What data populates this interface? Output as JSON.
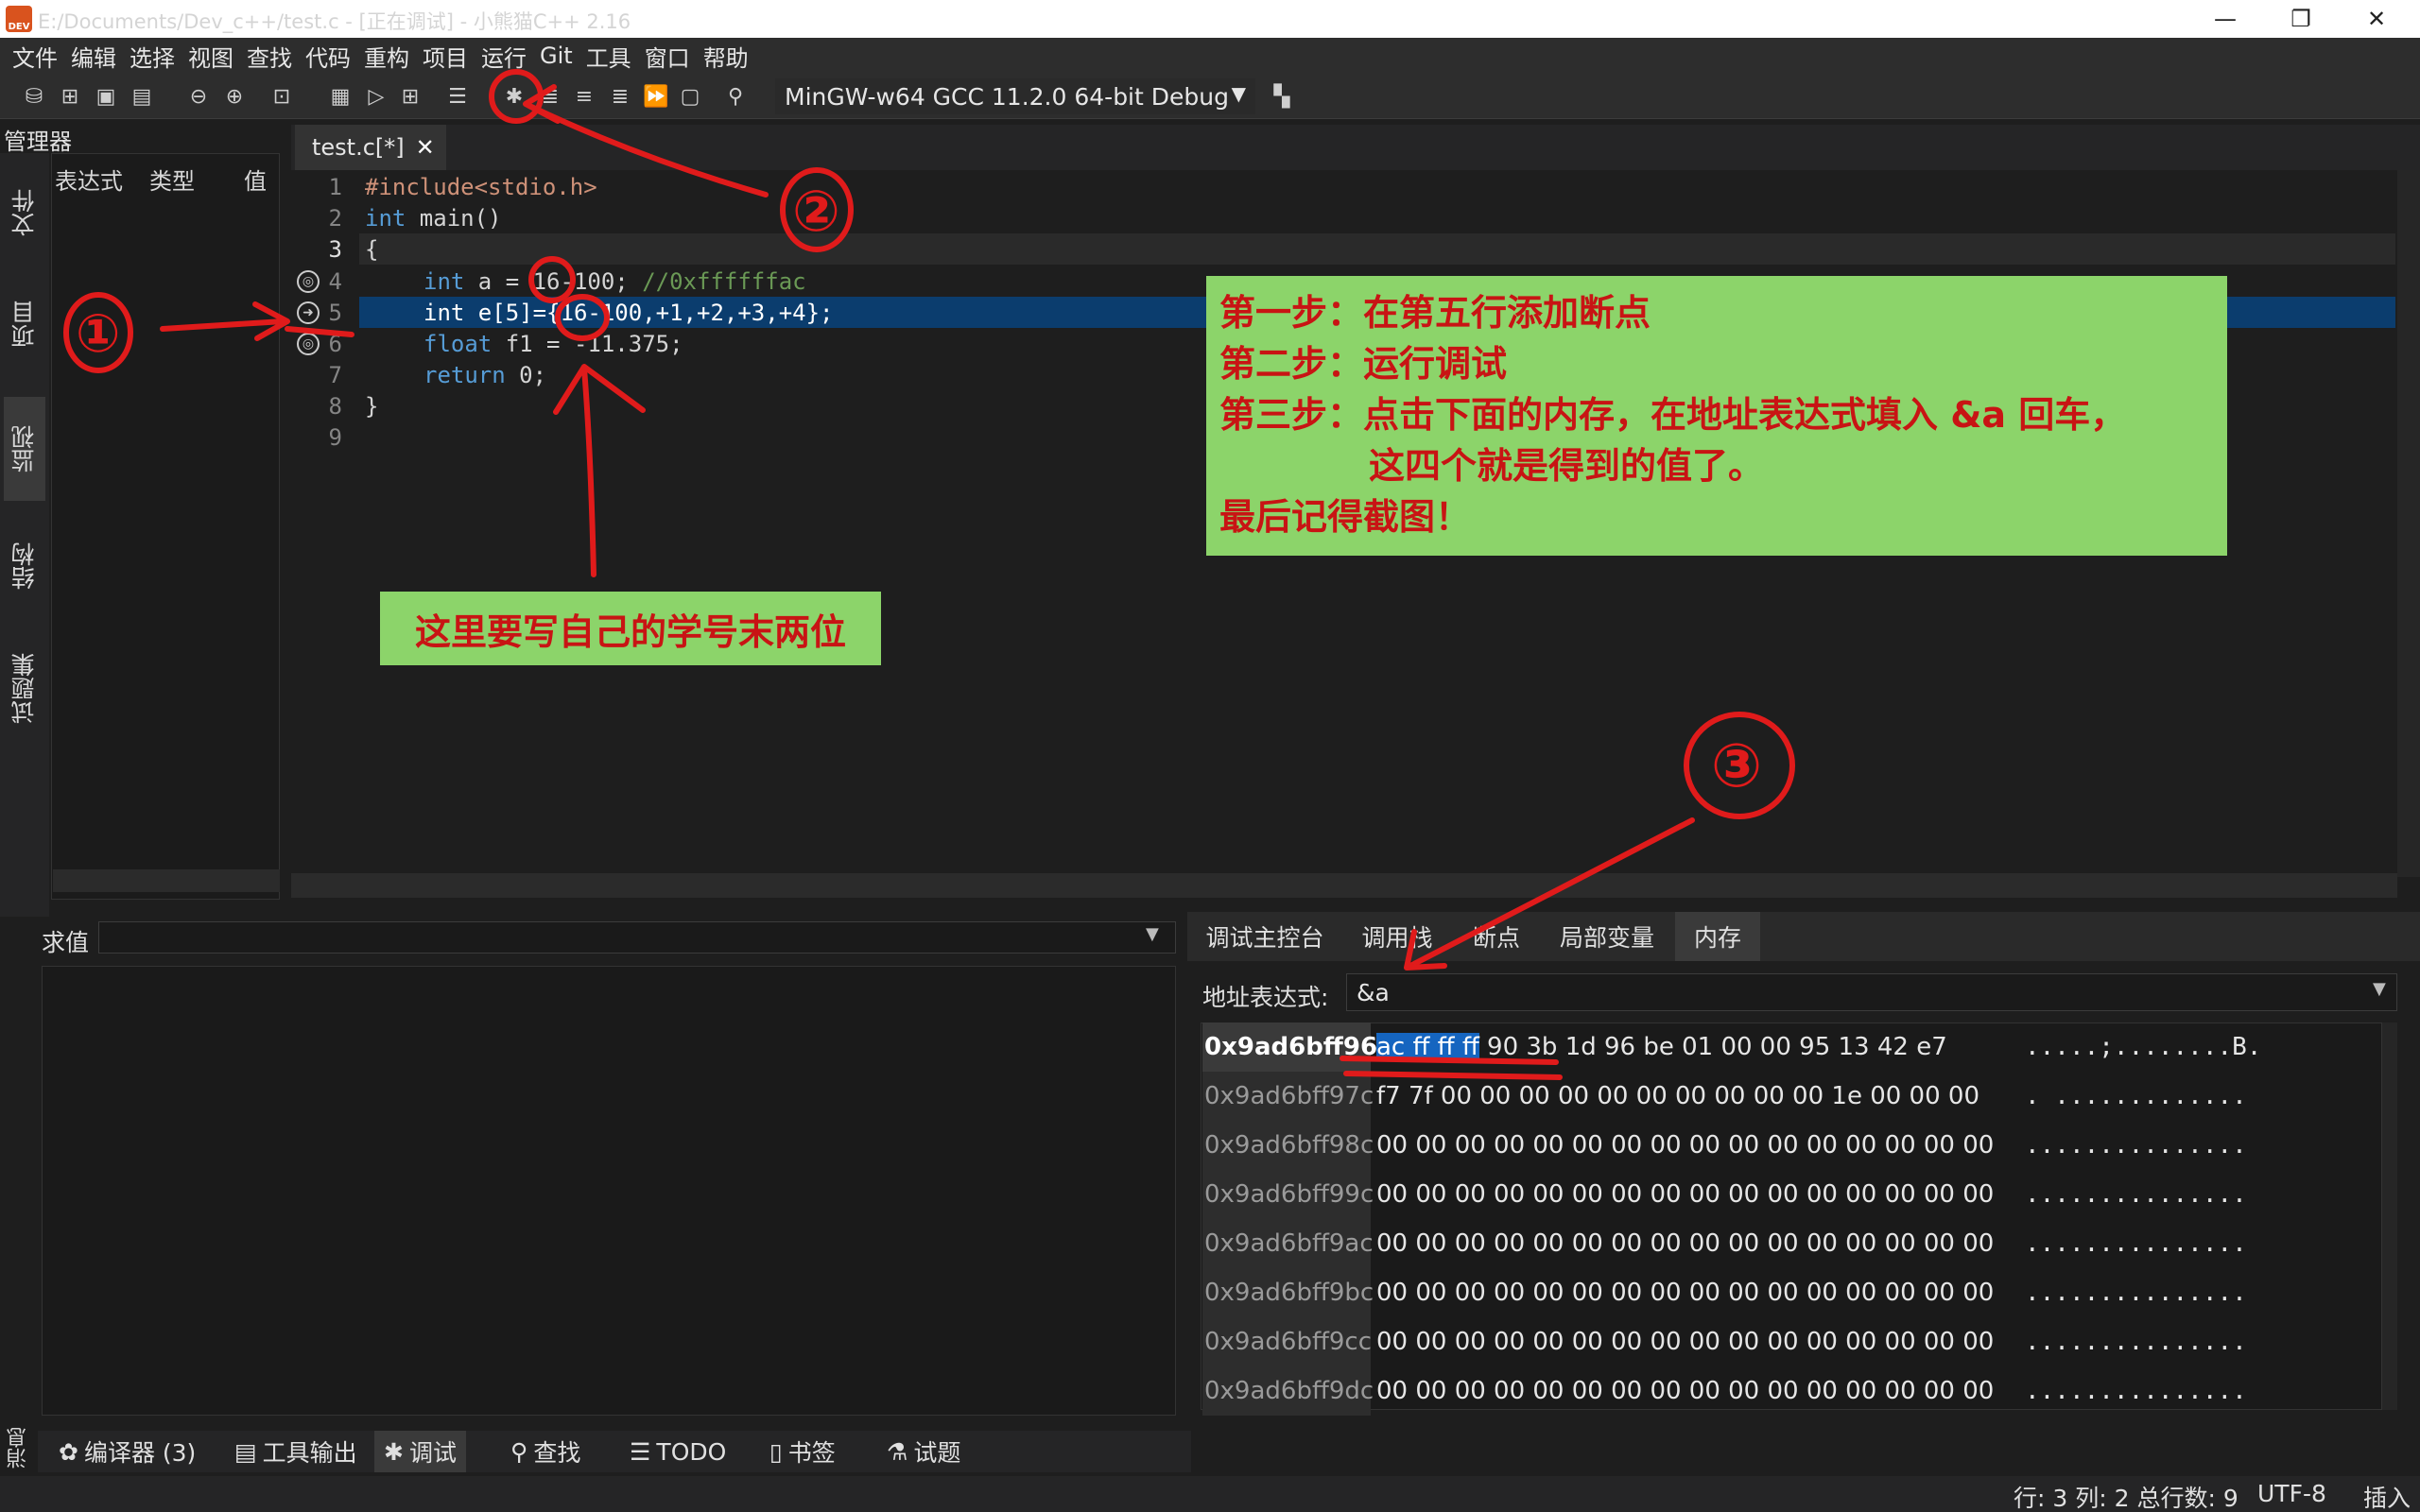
{
  "window": {
    "logo": "DEV",
    "title": "E:/Documents/Dev_c++/test.c  - [正在调试] - 小熊猫C++ 2.16"
  },
  "menu": [
    "文件",
    "编辑",
    "选择",
    "视图",
    "查找",
    "代码",
    "重构",
    "项目",
    "运行",
    "Git",
    "工具",
    "窗口",
    "帮助"
  ],
  "toolbar": {
    "compiler": "MinGW-w64 GCC 11.2.0 64-bit Debug"
  },
  "left_panel": {
    "title": "管理器",
    "tabs": [
      "文件",
      "项目",
      "监视",
      "结构",
      "试题集"
    ],
    "watch_headers": [
      "表达式",
      "类型",
      "值"
    ]
  },
  "editor": {
    "tab_label": "test.c[*]",
    "line_numbers": [
      "1",
      "2",
      "3",
      "4",
      "5",
      "6",
      "7",
      "8",
      "9"
    ],
    "code": {
      "l1": "#include<stdio.h>",
      "l2_kw": "int",
      "l2_rest": " main()",
      "l3": "{",
      "l4_kw": "int",
      "l4_rest": " a = 16-100; ",
      "l4_comment": "//0xffffffac",
      "l5_kw": "int",
      "l5_rest": " e[5]={16-100,+1,+2,+3,+4};",
      "l6_kw": "float",
      "l6_rest": " f1 = -11.375;",
      "l7_kw": "return",
      "l7_rest": " 0;",
      "l8": "}"
    }
  },
  "eval": {
    "label": "求值"
  },
  "debug": {
    "tabs": [
      "调试主控台",
      "调用栈",
      "断点",
      "局部变量",
      "内存"
    ],
    "active_tab": "内存",
    "address_label": "地址表达式:",
    "address_value": "&a",
    "memory": [
      {
        "addr": "0x9ad6bff96c",
        "hl": "ac ff ff ff",
        "bytes": " 90 3b 1d 96 be 01 00 00 95 13 42 e7",
        "ascii": ".....;........B."
      },
      {
        "addr": "0x9ad6bff97c",
        "hl": "",
        "bytes": "f7 7f 00 00 00 00 00 00 00 00 00 00 1e 00 00 00",
        "ascii": ". ............."
      },
      {
        "addr": "0x9ad6bff98c",
        "hl": "",
        "bytes": "00 00 00 00 00 00 00 00 00 00 00 00 00 00 00 00",
        "ascii": "..............."
      },
      {
        "addr": "0x9ad6bff99c",
        "hl": "",
        "bytes": "00 00 00 00 00 00 00 00 00 00 00 00 00 00 00 00",
        "ascii": "..............."
      },
      {
        "addr": "0x9ad6bff9ac",
        "hl": "",
        "bytes": "00 00 00 00 00 00 00 00 00 00 00 00 00 00 00 00",
        "ascii": "..............."
      },
      {
        "addr": "0x9ad6bff9bc",
        "hl": "",
        "bytes": "00 00 00 00 00 00 00 00 00 00 00 00 00 00 00 00",
        "ascii": "..............."
      },
      {
        "addr": "0x9ad6bff9cc",
        "hl": "",
        "bytes": "00 00 00 00 00 00 00 00 00 00 00 00 00 00 00 00",
        "ascii": "..............."
      },
      {
        "addr": "0x9ad6bff9dc",
        "hl": "",
        "bytes": "00 00 00 00 00 00 00 00 00 00 00 00 00 00 00 00",
        "ascii": "..............."
      }
    ]
  },
  "messages": {
    "vertical_label": "消息",
    "tabs": [
      "编译器 (3)",
      "工具输出",
      "调试",
      "查找",
      "TODO",
      "书签",
      "试题"
    ]
  },
  "status": {
    "position": "行: 3 列: 2 总行数: 9",
    "encoding": "UTF-8",
    "mode": "插入"
  },
  "annotations": {
    "steps": [
      "第一步：在第五行添加断点",
      "第二步：运行调试",
      "第三步：点击下面的内存，在地址表达式填入 &a 回车，",
      "这四个就是得到的值了。",
      "最后记得截图！"
    ],
    "id_note": "这里要写自己的学号末两位",
    "markers": [
      "①",
      "②",
      "③"
    ],
    "color": "#e01b1b",
    "note_bg": "#8cd46a"
  }
}
